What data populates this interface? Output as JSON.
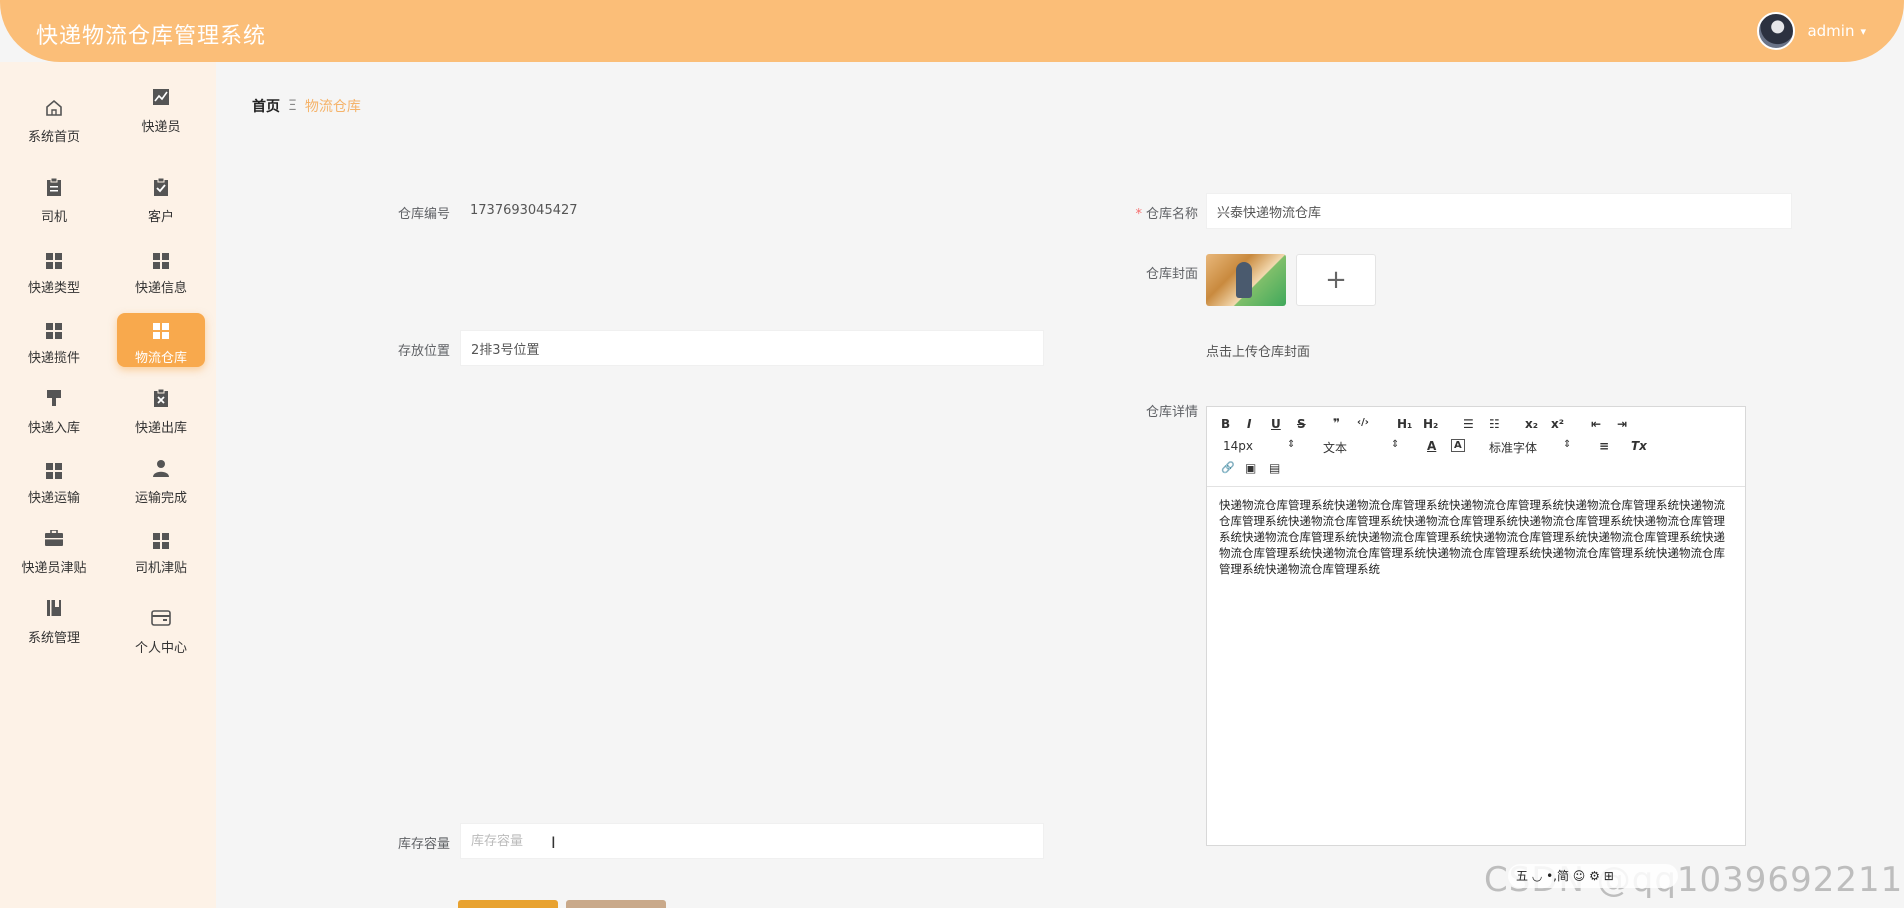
{
  "header": {
    "title": "快递物流仓库管理系统",
    "user_name": "admin",
    "caret": "▾"
  },
  "sidebar": {
    "items": [
      {
        "label": "系统首页",
        "icon": "home-icon"
      },
      {
        "label": "快递员",
        "icon": "chart-icon"
      },
      {
        "label": "司机",
        "icon": "clipboard-icon"
      },
      {
        "label": "客户",
        "icon": "clipboard-check-icon"
      },
      {
        "label": "快递类型",
        "icon": "grid-icon"
      },
      {
        "label": "快递信息",
        "icon": "grid-icon"
      },
      {
        "label": "快递揽件",
        "icon": "grid-icon"
      },
      {
        "label": "物流仓库",
        "icon": "grid-icon",
        "active": true
      },
      {
        "label": "快递入库",
        "icon": "brush-icon"
      },
      {
        "label": "快递出库",
        "icon": "clipboard-x-icon"
      },
      {
        "label": "快递运输",
        "icon": "grid-icon"
      },
      {
        "label": "运输完成",
        "icon": "user-icon"
      },
      {
        "label": "快递员津贴",
        "icon": "briefcase-icon"
      },
      {
        "label": "司机津贴",
        "icon": "grid-icon"
      },
      {
        "label": "系统管理",
        "icon": "book-icon"
      },
      {
        "label": "个人中心",
        "icon": "wallet-icon"
      }
    ]
  },
  "breadcrumb": {
    "home": "首页",
    "separator": "Ξ",
    "current": "物流仓库"
  },
  "form": {
    "code_label": "仓库编号",
    "code_value": "1737693045427",
    "name_label": "仓库名称",
    "name_required": "*",
    "name_value": "兴泰快递物流仓库",
    "cover_label": "仓库封面",
    "upload_plus": "+",
    "cover_hint": "点击上传仓库封面",
    "location_label": "存放位置",
    "location_value": "2排3号位置",
    "detail_label": "仓库详情",
    "capacity_label": "库存容量",
    "capacity_placeholder": "库存容量"
  },
  "editor": {
    "toolbar": {
      "bold": "B",
      "italic": "I",
      "underline": "U",
      "strike": "S",
      "quote": "❞",
      "code": "‹/›",
      "h1": "H₁",
      "h2": "H₂",
      "ordered_list": "☰",
      "bullet_list": "☷",
      "subscript": "x₂",
      "superscript": "x²",
      "outdent": "⇤",
      "indent": "⇥",
      "size": "14px",
      "size_caret": "⇕",
      "format": "文本",
      "format_caret": "⇕",
      "color": "A",
      "background": "A",
      "font": "标准字体",
      "font_caret": "⇕",
      "align": "≡",
      "clear": "Tx",
      "link": "🔗",
      "image": "▣",
      "video": "▤"
    },
    "content": "快递物流仓库管理系统快递物流仓库管理系统快递物流仓库管理系统快递物流仓库管理系统快递物流仓库管理系统快递物流仓库管理系统快递物流仓库管理系统快递物流仓库管理系统快递物流仓库管理系统快递物流仓库管理系统快递物流仓库管理系统快递物流仓库管理系统快递物流仓库管理系统快递物流仓库管理系统快递物流仓库管理系统快递物流仓库管理系统快递物流仓库管理系统快递物流仓库管理系统快递物流仓库管理系统"
  },
  "watermark": "CSDN @qq1039692211",
  "ime": "五 ◡ •,简 ☺ ⚙ ⊞"
}
